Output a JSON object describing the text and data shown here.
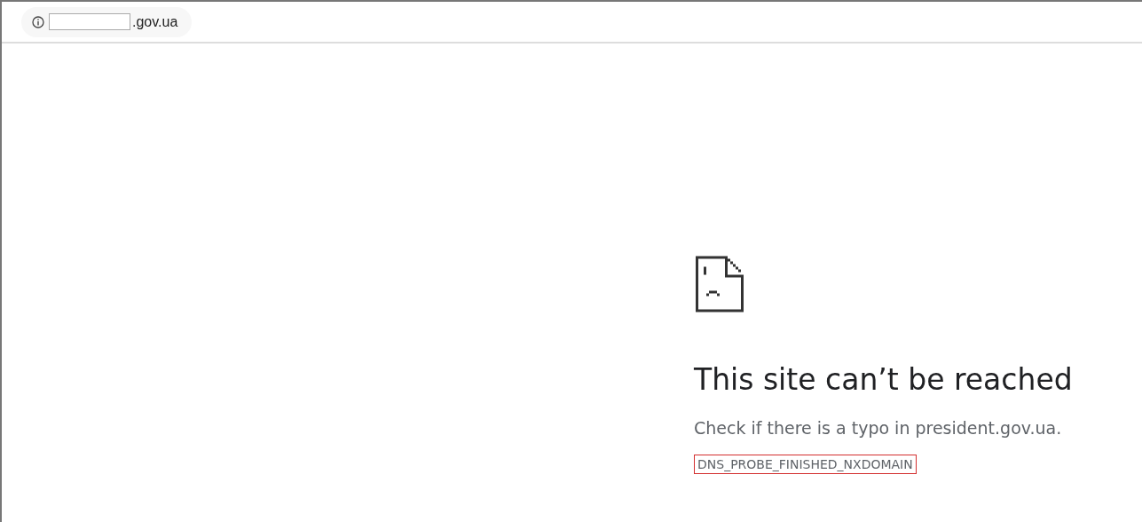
{
  "address_bar": {
    "url_suffix": ".gov.ua"
  },
  "error": {
    "title": "This site can’t be reached",
    "message": "Check if there is a typo in president.gov.ua.",
    "code": "DNS_PROBE_FINISHED_NXDOMAIN",
    "code_highlighted": true
  }
}
